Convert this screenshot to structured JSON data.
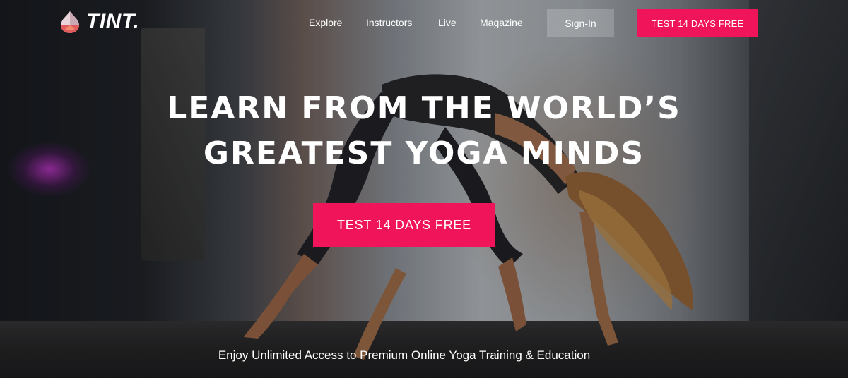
{
  "brand": {
    "name": "TINT.",
    "logo_icon": "droplet-gem-icon"
  },
  "nav": {
    "links": [
      "Explore",
      "Instructors",
      "Live",
      "Magazine"
    ],
    "signin_label": "Sign-In",
    "cta_label": "TEST 14 DAYS FREE"
  },
  "hero": {
    "headline_line1": "LEARN FROM THE WORLD’S",
    "headline_line2": "GREATEST YOGA MINDS",
    "cta_label": "TEST 14 DAYS FREE",
    "subtitle": "Enjoy Unlimited Access to Premium Online Yoga Training & Education"
  },
  "colors": {
    "accent": "#f0145a",
    "text": "#ffffff"
  }
}
